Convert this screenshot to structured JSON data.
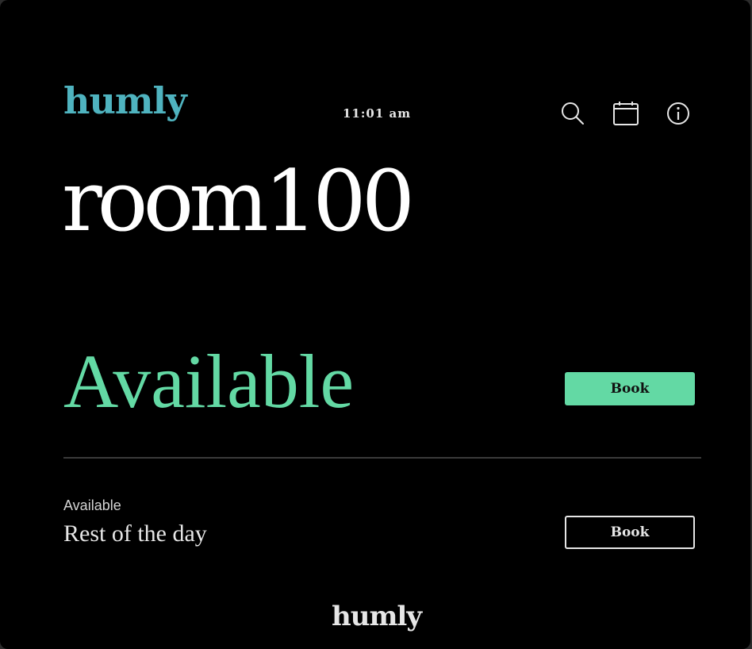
{
  "header": {
    "logo_text": "humly",
    "clock": "11:01 am",
    "icons": [
      "search-icon",
      "calendar-icon",
      "info-icon"
    ]
  },
  "room": {
    "name": "room100"
  },
  "current": {
    "status": "Available",
    "book_label": "Book"
  },
  "upcoming": {
    "status_label": "Available",
    "time_label": "Rest of the day",
    "book_label": "Book"
  },
  "footer": {
    "logo_text": "humly"
  },
  "colors": {
    "background": "#000000",
    "brand_teal": "#4fb3bf",
    "available_green": "#63d9a4",
    "text_light": "#e6e6e6"
  }
}
